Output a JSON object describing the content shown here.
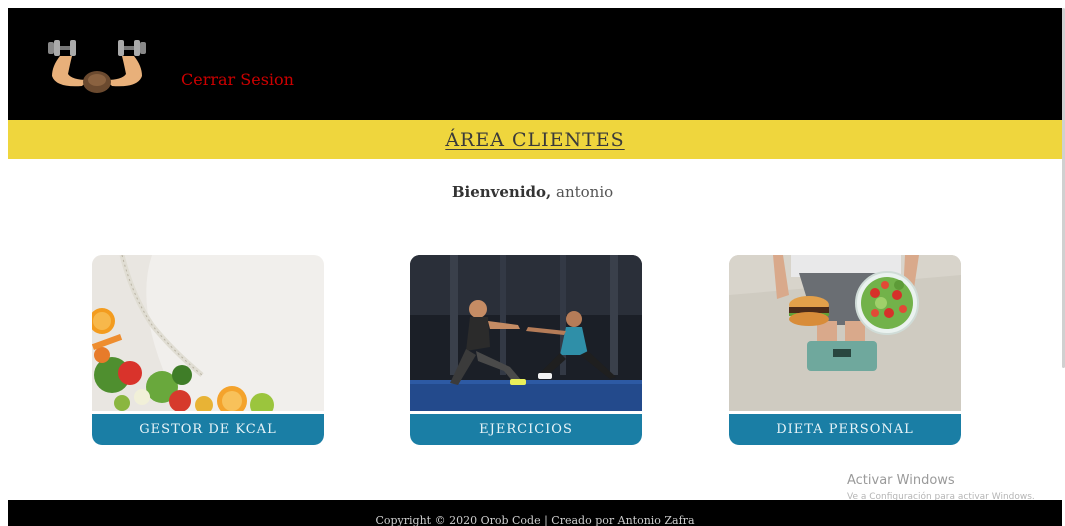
{
  "header": {
    "logout_label": "Cerrar Sesion"
  },
  "section": {
    "title": "ÁREA CLIENTES"
  },
  "welcome": {
    "greeting": "Bienvenido,",
    "username": "antonio"
  },
  "cards": [
    {
      "label": "GESTOR DE KCAL"
    },
    {
      "label": "EJERCICIOS"
    },
    {
      "label": "DIETA PERSONAL"
    }
  ],
  "footer": {
    "copyright": "Copyright © 2020 Orob Code | Creado por Antonio Zafra"
  },
  "watermark": {
    "title": "Activar Windows",
    "subtitle": "Ve a Configuración para activar Windows."
  },
  "colors": {
    "header_bg": "#000000",
    "section_bar": "#efd63d",
    "card_button": "#1a7ea5",
    "logout_link": "#cc0000"
  }
}
